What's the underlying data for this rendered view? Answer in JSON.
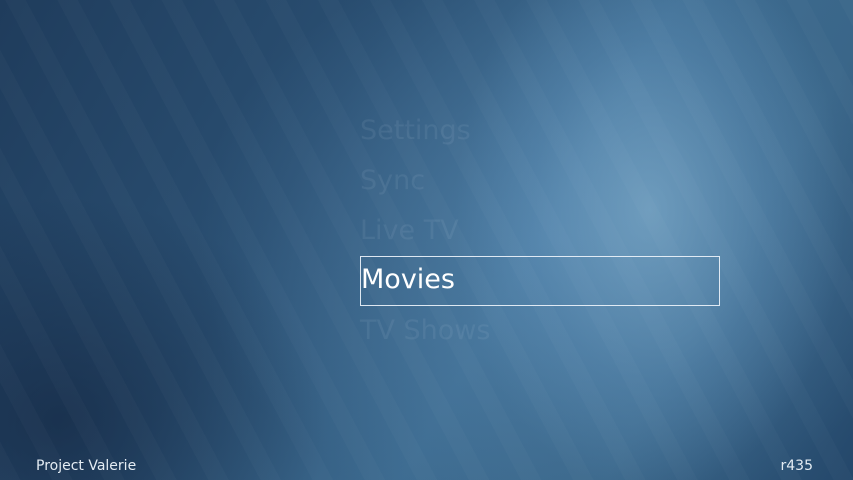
{
  "menu": {
    "items": [
      {
        "label": "Settings",
        "selected": false
      },
      {
        "label": "Sync",
        "selected": false
      },
      {
        "label": "Live TV",
        "selected": false
      },
      {
        "label": "Movies",
        "selected": true
      },
      {
        "label": "TV Shows",
        "selected": false
      }
    ]
  },
  "footer": {
    "app_name": "Project Valerie",
    "version": "r435"
  },
  "colors": {
    "background": "#2a4f72",
    "highlight_border": "#ebf2fa",
    "text": "#ffffff"
  }
}
